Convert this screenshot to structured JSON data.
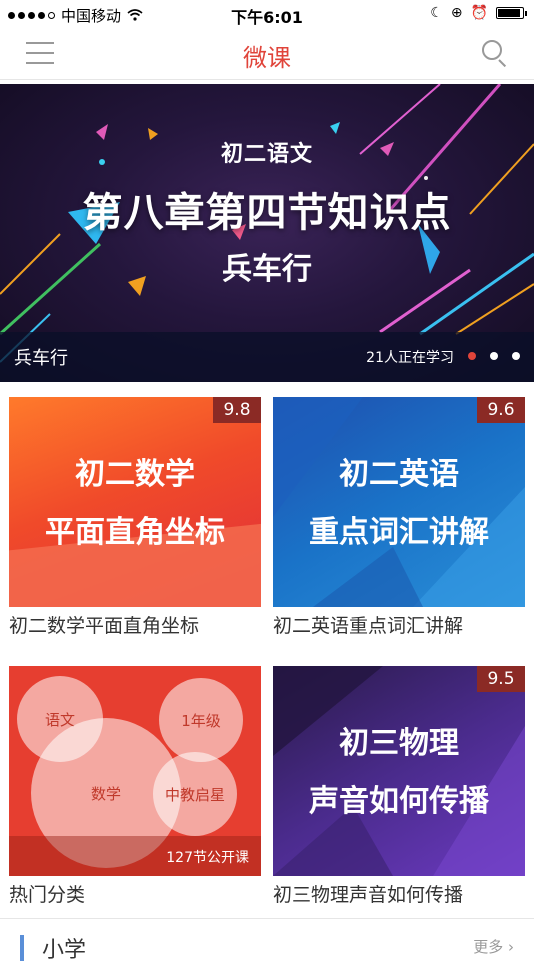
{
  "status_bar": {
    "carrier": "中国移动",
    "time": "下午6:01"
  },
  "nav": {
    "title": "微课"
  },
  "banner": {
    "subtitle": "初二语文",
    "headline": "第八章第四节知识点",
    "line3": "兵车行",
    "caption_title": "兵车行",
    "learners": "21人正在学习"
  },
  "cards": [
    {
      "score": "9.8",
      "thumb_line1": "初二数学",
      "thumb_line2": "平面直角坐标",
      "label": "初二数学平面直角坐标"
    },
    {
      "score": "9.6",
      "thumb_line1": "初二英语",
      "thumb_line2": "重点词汇讲解",
      "label": "初二英语重点词汇讲解"
    },
    {
      "bubbles": [
        "语文",
        "1年级",
        "数学",
        "中教启星"
      ],
      "count": "127节公开课",
      "label": "热门分类"
    },
    {
      "score": "9.5",
      "thumb_line1": "初三物理",
      "thumb_line2": "声音如何传播",
      "label": "初三物理声音如何传播"
    }
  ],
  "section": {
    "title": "小学",
    "more": "更多"
  },
  "colors": {
    "accent": "#e0443a",
    "section_bar": "#5a8fd8"
  }
}
